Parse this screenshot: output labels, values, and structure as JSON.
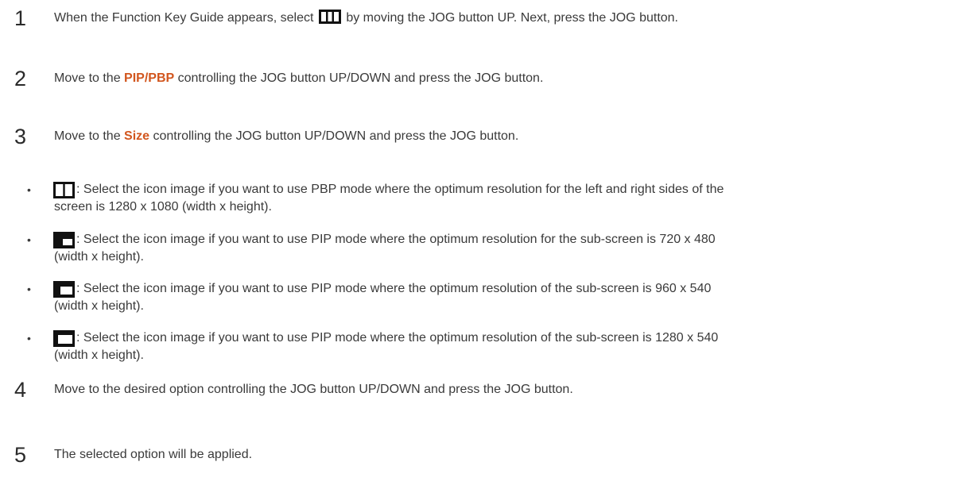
{
  "steps": [
    {
      "num": "1",
      "before": "When the Function Key Guide appears, select",
      "icon": "pbp-menu-icon",
      "after": "by moving the JOG button UP. Next, press the JOG button."
    },
    {
      "num": "2",
      "before": "Move to the ",
      "highlight": "PIP/PBP",
      "after": " controlling the JOG button UP/DOWN and press the JOG button."
    },
    {
      "num": "3",
      "before": "Move to the ",
      "highlight": "Size",
      "after": " controlling the JOG button UP/DOWN and press the JOG button."
    },
    {
      "num": "4",
      "text": "Move to the desired option controlling the JOG button UP/DOWN and press the JOG button."
    },
    {
      "num": "5",
      "text": "The selected option will be applied."
    }
  ],
  "bullets": [
    {
      "icon": "pbp-split-icon",
      "line1": ": Select the icon image if you want to use PBP mode where the optimum resolution for the left and right sides of the",
      "line2": "screen is 1280 x 1080 (width x height)."
    },
    {
      "icon": "pip-small-icon",
      "line1": ": Select the icon image if you want to use PIP mode where the optimum resolution for the sub-screen is 720 x 480",
      "line2": "(width x height)."
    },
    {
      "icon": "pip-medium-icon",
      "line1": ": Select the icon image if you want to use PIP mode where the optimum resolution of the sub-screen is 960 x 540",
      "line2": "(width x height)."
    },
    {
      "icon": "pip-large-icon",
      "line1": ": Select the icon image if you want to use PIP mode where the optimum resolution of the sub-screen is 1280 x 540",
      "line2": "(width x height)."
    }
  ],
  "colors": {
    "highlight": "#d2561e",
    "text": "#3a3a3a"
  },
  "bullet_glyph": "•"
}
